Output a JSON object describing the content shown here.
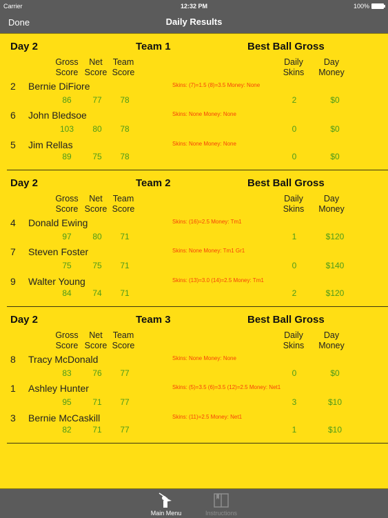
{
  "status_bar": {
    "carrier": "Carrier",
    "time": "12:32 PM",
    "battery": "100%"
  },
  "navbar": {
    "done_label": "Done",
    "title": "Daily Results"
  },
  "column_headers": {
    "gross": [
      "Gross",
      "Score"
    ],
    "net": [
      "Net",
      "Score"
    ],
    "team": [
      "Team",
      "Score"
    ],
    "skins": [
      "Daily",
      "Skins"
    ],
    "money": [
      "Day",
      "Money"
    ]
  },
  "sections": [
    {
      "day": "Day 2",
      "team": "Team 1",
      "format": "Best Ball Gross",
      "players": [
        {
          "num": "2",
          "name": "Bernie DiFiore",
          "note": "Skins: (7)=1.5 (8)=3.5  Money: None",
          "gross": "86",
          "net": "77",
          "team": "78",
          "skins": "2",
          "money": "$0"
        },
        {
          "num": "6",
          "name": "John Bledsoe",
          "note": "Skins: None Money: None",
          "gross": "103",
          "net": "80",
          "team": "78",
          "skins": "0",
          "money": "$0"
        },
        {
          "num": "5",
          "name": "Jim Rellas",
          "note": "Skins: None Money: None",
          "gross": "89",
          "net": "75",
          "team": "78",
          "skins": "0",
          "money": "$0"
        }
      ]
    },
    {
      "day": "Day 2",
      "team": "Team 2",
      "format": "Best Ball Gross",
      "players": [
        {
          "num": "4",
          "name": "Donald Ewing",
          "note": "Skins: (16)=2.5  Money: Tm1",
          "gross": "97",
          "net": "80",
          "team": "71",
          "skins": "1",
          "money": "$120"
        },
        {
          "num": "7",
          "name": "Steven Foster",
          "note": "Skins: None Money: Tm1 Gr1",
          "gross": "75",
          "net": "75",
          "team": "71",
          "skins": "0",
          "money": "$140"
        },
        {
          "num": "9",
          "name": "Walter Young",
          "note": "Skins: (13)=3.0 (14)=2.5  Money: Tm1",
          "gross": "84",
          "net": "74",
          "team": "71",
          "skins": "2",
          "money": "$120"
        }
      ]
    },
    {
      "day": "Day 2",
      "team": "Team 3",
      "format": "Best Ball Gross",
      "players": [
        {
          "num": "8",
          "name": "Tracy McDonald",
          "note": "Skins: None Money: None",
          "gross": "83",
          "net": "76",
          "team": "77",
          "skins": "0",
          "money": "$0"
        },
        {
          "num": "1",
          "name": "Ashley Hunter",
          "note": "Skins: (5)=3.5 (6)=3.5 (12)=2.5  Money: Net1",
          "gross": "95",
          "net": "71",
          "team": "77",
          "skins": "3",
          "money": "$10"
        },
        {
          "num": "3",
          "name": "Bernie McCaskill",
          "note": "Skins: (11)=2.5  Money: Net1",
          "gross": "82",
          "net": "71",
          "team": "77",
          "skins": "1",
          "money": "$10"
        }
      ]
    }
  ],
  "tabbar": {
    "items": [
      {
        "label": "Main Menu",
        "icon": "golfer-icon",
        "active": true
      },
      {
        "label": "Instructions",
        "icon": "book-icon",
        "active": false
      }
    ]
  },
  "colors": {
    "background": "#ffde14",
    "bar": "#5b5b5b",
    "score_green": "#4c9a1b",
    "note_red": "#f5410a"
  }
}
